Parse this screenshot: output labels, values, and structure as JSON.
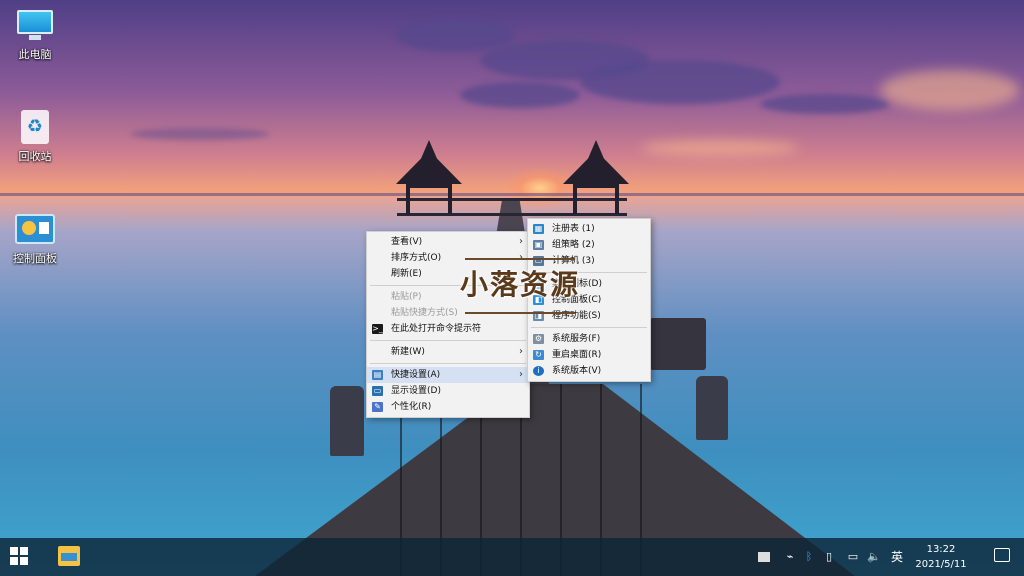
{
  "desktop_icons": [
    {
      "label": "此电脑",
      "icon": "computer-icon"
    },
    {
      "label": "回收站",
      "icon": "recycle-bin-icon"
    },
    {
      "label": "控制面板",
      "icon": "control-panel-icon"
    }
  ],
  "context_menu": {
    "items": [
      {
        "label": "查看(V)",
        "submenu": true
      },
      {
        "label": "排序方式(O)",
        "submenu": true
      },
      {
        "label": "刷新(E)"
      },
      {
        "separator": true
      },
      {
        "label": "粘贴(P)",
        "disabled": true
      },
      {
        "label": "粘贴快捷方式(S)",
        "disabled": true
      },
      {
        "label": "在此处打开命令提示符",
        "icon": "command-prompt-icon"
      },
      {
        "separator": true
      },
      {
        "label": "新建(W)",
        "submenu": true
      },
      {
        "separator": true
      },
      {
        "label": "快捷设置(A)",
        "submenu": true,
        "icon": "quick-settings-icon",
        "highlighted": true
      },
      {
        "label": "显示设置(D)",
        "icon": "display-settings-icon"
      },
      {
        "label": "个性化(R)",
        "icon": "personalize-icon"
      }
    ]
  },
  "submenu": {
    "items": [
      {
        "label": "注册表 (1)",
        "icon": "registry-icon"
      },
      {
        "label": "组策略 (2)",
        "icon": "group-policy-icon"
      },
      {
        "label": "计算机 (3)",
        "icon": "computer-manage-icon"
      },
      {
        "separator": true
      },
      {
        "label": "桌面图标(D)",
        "icon": "desktop-icons-icon"
      },
      {
        "label": "控制面板(C)",
        "icon": "control-panel-icon"
      },
      {
        "label": "程序功能(S)",
        "icon": "programs-icon"
      },
      {
        "separator": true
      },
      {
        "label": "系统服务(F)",
        "icon": "services-icon"
      },
      {
        "label": "重启桌面(R)",
        "icon": "restart-icon"
      },
      {
        "label": "系统版本(V)",
        "icon": "info-icon"
      }
    ]
  },
  "watermark": {
    "text": "小落资源"
  },
  "taskbar": {
    "tray_ime": "英",
    "time": "13:22",
    "date": "2021/5/11"
  },
  "colors": {
    "menu_bg": "#f2f2f2",
    "menu_highlight": "#d5e1f2",
    "taskbar_bg": "#0e2638"
  }
}
